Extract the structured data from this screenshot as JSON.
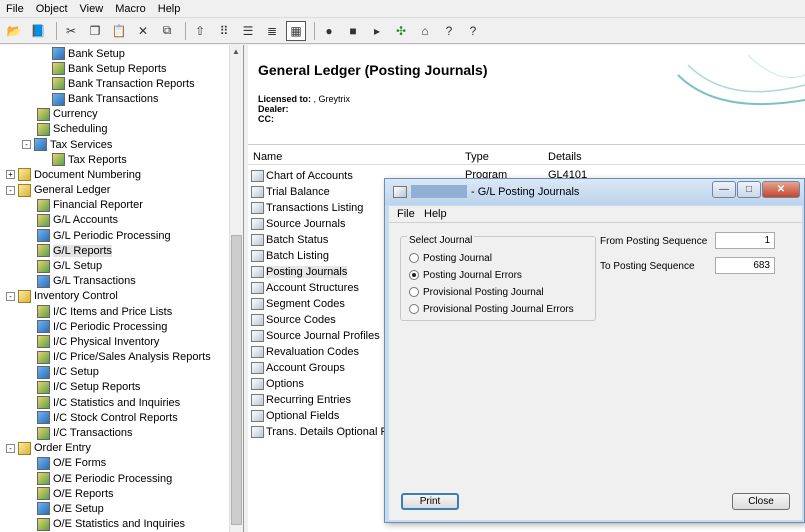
{
  "menubar": [
    "File",
    "Object",
    "View",
    "Macro",
    "Help"
  ],
  "toolbar": {
    "icons": [
      "open-folder-icon",
      "book-icon",
      "cut-icon",
      "copy-icon",
      "paste-icon",
      "delete-icon",
      "properties-icon",
      "up-folder-icon",
      "small-icons-icon",
      "list-icon",
      "details-icon",
      "grid-icon",
      "record-icon",
      "stop-icon",
      "play-icon",
      "network-icon",
      "home-icon",
      "help-icon",
      "whats-this-icon"
    ]
  },
  "tree": {
    "items": [
      {
        "label": "Bank Setup",
        "level": 3
      },
      {
        "label": "Bank Setup Reports",
        "level": 3
      },
      {
        "label": "Bank Transaction Reports",
        "level": 3
      },
      {
        "label": "Bank Transactions",
        "level": 3
      },
      {
        "label": "Currency",
        "level": 2
      },
      {
        "label": "Scheduling",
        "level": 2
      },
      {
        "label": "Tax Services",
        "level": 2,
        "expander": "-"
      },
      {
        "label": "Tax Reports",
        "level": 3
      },
      {
        "label": "Document Numbering",
        "level": 1,
        "expander": "+"
      },
      {
        "label": "General Ledger",
        "level": 1,
        "expander": "-"
      },
      {
        "label": "Financial Reporter",
        "level": 2
      },
      {
        "label": "G/L Accounts",
        "level": 2
      },
      {
        "label": "G/L Periodic Processing",
        "level": 2
      },
      {
        "label": "G/L Reports",
        "level": 2,
        "selected": true
      },
      {
        "label": "G/L Setup",
        "level": 2
      },
      {
        "label": "G/L Transactions",
        "level": 2
      },
      {
        "label": "Inventory Control",
        "level": 1,
        "expander": "-"
      },
      {
        "label": "I/C Items and Price Lists",
        "level": 2
      },
      {
        "label": "I/C Periodic Processing",
        "level": 2
      },
      {
        "label": "I/C Physical Inventory",
        "level": 2
      },
      {
        "label": "I/C Price/Sales Analysis Reports",
        "level": 2
      },
      {
        "label": "I/C Setup",
        "level": 2
      },
      {
        "label": "I/C Setup Reports",
        "level": 2
      },
      {
        "label": "I/C Statistics and Inquiries",
        "level": 2
      },
      {
        "label": "I/C Stock Control Reports",
        "level": 2
      },
      {
        "label": "I/C Transactions",
        "level": 2
      },
      {
        "label": "Order Entry",
        "level": 1,
        "expander": "-"
      },
      {
        "label": "O/E Forms",
        "level": 2
      },
      {
        "label": "O/E Periodic Processing",
        "level": 2
      },
      {
        "label": "O/E Reports",
        "level": 2
      },
      {
        "label": "O/E Setup",
        "level": 2
      },
      {
        "label": "O/E Statistics and Inquiries",
        "level": 2
      }
    ]
  },
  "panel": {
    "title": "General Ledger (Posting Journals)",
    "licensed_label": "Licensed to:",
    "licensed_value": ", Greytrix",
    "dealer_label": "Dealer:",
    "cc_label": "CC:",
    "columns": [
      "Name",
      "Type",
      "Details"
    ],
    "rows": [
      {
        "name": "Chart of Accounts",
        "type": "Program",
        "details": "GL4101"
      },
      {
        "name": "Trial Balance"
      },
      {
        "name": "Transactions Listing"
      },
      {
        "name": "Source Journals"
      },
      {
        "name": "Batch Status"
      },
      {
        "name": "Batch Listing"
      },
      {
        "name": "Posting Journals",
        "selected": true
      },
      {
        "name": "Account Structures"
      },
      {
        "name": "Segment Codes"
      },
      {
        "name": "Source Codes"
      },
      {
        "name": "Source Journal Profiles"
      },
      {
        "name": "Revaluation Codes"
      },
      {
        "name": "Account Groups"
      },
      {
        "name": "Options"
      },
      {
        "name": "Recurring Entries"
      },
      {
        "name": "Optional Fields"
      },
      {
        "name": "Trans. Details Optional Fie"
      }
    ]
  },
  "dialog": {
    "title": "- G/L Posting Journals",
    "menu": [
      "File",
      "Help"
    ],
    "group_label": "Select Journal",
    "options": [
      {
        "label": "Posting Journal",
        "checked": false
      },
      {
        "label": "Posting Journal Errors",
        "checked": true
      },
      {
        "label": "Provisional Posting Journal",
        "checked": false
      },
      {
        "label": "Provisional Posting Journal Errors",
        "checked": false
      }
    ],
    "from_label": "From Posting Sequence",
    "from_value": "1",
    "to_label": "To Posting Sequence",
    "to_value": "683",
    "print_label": "Print",
    "close_label": "Close",
    "win_minimize": "—",
    "win_maximize": "□",
    "win_close": "✕"
  }
}
